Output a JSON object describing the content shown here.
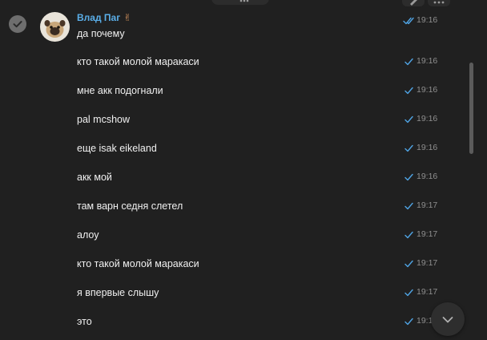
{
  "chat": {
    "sender": {
      "name": "Влад Паг",
      "status_emoji": "✌"
    },
    "messages": [
      {
        "text": "да почему",
        "time": "19:16",
        "read": true
      },
      {
        "text": "кто такой молой маракаси",
        "time": "19:16",
        "read": false
      },
      {
        "text": "мне акк подогнали",
        "time": "19:16",
        "read": false
      },
      {
        "text": "pal mcshow",
        "time": "19:16",
        "read": false
      },
      {
        "text": "еще isak eikeland",
        "time": "19:16",
        "read": false
      },
      {
        "text": "акк мой",
        "time": "19:16",
        "read": false
      },
      {
        "text": "там варн седня слетел",
        "time": "19:17",
        "read": false
      },
      {
        "text": "алоу",
        "time": "19:17",
        "read": false
      },
      {
        "text": "кто такой молой маракаси",
        "time": "19:17",
        "read": false
      },
      {
        "text": "я впервые слышу",
        "time": "19:17",
        "read": false
      },
      {
        "text": "это",
        "time": "19:1",
        "read": false
      }
    ]
  },
  "icons": {
    "select": "checkmark-circle-icon",
    "sent": "single-check-icon",
    "read": "double-check-icon",
    "edit": "pencil-icon",
    "more": "more-dots-icon",
    "scroll_down": "chevron-down-icon"
  },
  "colors": {
    "background": "#202020",
    "sender_name": "#5aaee8",
    "check": "#4fa3e3",
    "timestamp": "#8e8e8e"
  }
}
